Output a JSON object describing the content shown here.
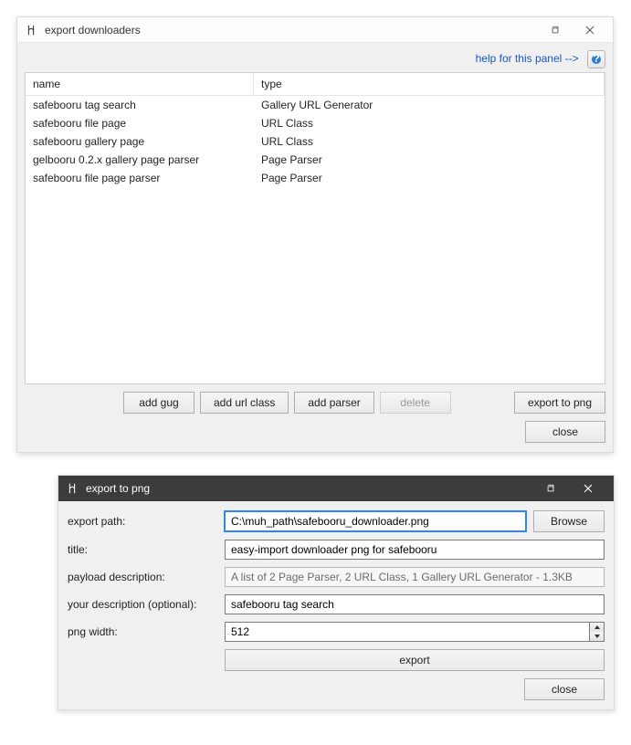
{
  "window1": {
    "title": "export downloaders",
    "help_link": "help for this panel -->",
    "columns": {
      "name": "name",
      "type": "type"
    },
    "rows": [
      {
        "name": "safebooru tag search",
        "type": "Gallery URL Generator"
      },
      {
        "name": "safebooru file page",
        "type": "URL Class"
      },
      {
        "name": "safebooru gallery page",
        "type": "URL Class"
      },
      {
        "name": "gelbooru 0.2.x gallery page parser",
        "type": "Page Parser"
      },
      {
        "name": "safebooru file page parser",
        "type": "Page Parser"
      }
    ],
    "buttons": {
      "add_gug": "add gug",
      "add_url_class": "add url class",
      "add_parser": "add parser",
      "delete": "delete",
      "export_png": "export to png",
      "close": "close"
    }
  },
  "window2": {
    "title": "export to png",
    "labels": {
      "export_path": "export path:",
      "title": "title:",
      "payload_desc": "payload description:",
      "your_desc": "your description (optional):",
      "png_width": "png width:"
    },
    "values": {
      "export_path": "C:\\muh_path\\safebooru_downloader.png",
      "title": "easy-import downloader png for safebooru",
      "payload_desc": "A list of 2 Page Parser, 2 URL Class, 1 Gallery URL Generator - 1.3KB",
      "your_desc": "safebooru tag search",
      "png_width": "512"
    },
    "buttons": {
      "browse": "Browse",
      "export": "export",
      "close": "close"
    }
  }
}
